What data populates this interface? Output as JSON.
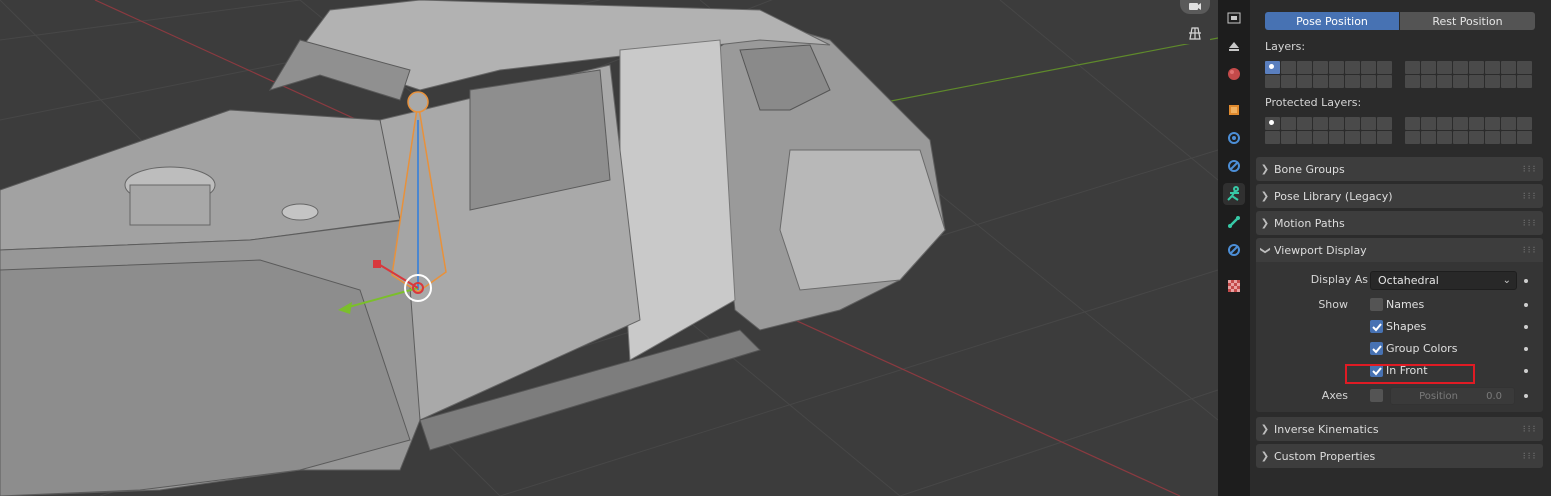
{
  "viewport": {
    "gizmos": [
      "camera-icon",
      "grid-icon"
    ]
  },
  "tabs": [
    {
      "name": "render-tab",
      "icon": "render-icon"
    },
    {
      "name": "view-layer-tab",
      "icon": "view-layer-icon"
    },
    {
      "name": "world-tab",
      "icon": "world-icon"
    },
    {
      "name": "object-tab",
      "icon": "object-icon"
    },
    {
      "name": "physics-tab",
      "icon": "physics-icon"
    },
    {
      "name": "constraints-tab",
      "icon": "constraints-icon"
    },
    {
      "name": "armature-data-tab",
      "icon": "armature-icon",
      "active": true
    },
    {
      "name": "bone-tab",
      "icon": "bone-icon"
    },
    {
      "name": "bone-constraints-tab",
      "icon": "bone-constraint-icon"
    },
    {
      "name": "texture-tab",
      "icon": "texture-icon"
    }
  ],
  "pose": {
    "pose_position": "Pose Position",
    "rest_position": "Rest Position",
    "active": "Pose Position"
  },
  "layers": {
    "label": "Layers:",
    "protected_label": "Protected Layers:"
  },
  "sections": {
    "bone_groups": "Bone Groups",
    "pose_library": "Pose Library (Legacy)",
    "motion_paths": "Motion Paths",
    "viewport_display": "Viewport Display",
    "inverse_kinematics": "Inverse Kinematics",
    "custom_properties": "Custom Properties"
  },
  "viewport_display": {
    "display_as_label": "Display As",
    "display_as_value": "Octahedral",
    "show_label": "Show",
    "names": {
      "label": "Names",
      "checked": false
    },
    "shapes": {
      "label": "Shapes",
      "checked": true
    },
    "group_colors": {
      "label": "Group Colors",
      "checked": true
    },
    "in_front": {
      "label": "In Front",
      "checked": true
    },
    "axes_label": "Axes",
    "axes_checked": false,
    "position_label": "Position",
    "position_value": "0.0"
  },
  "colors": {
    "accent": "#4772b3",
    "highlight": "#e01b24",
    "bone_select": "#e8913b"
  }
}
